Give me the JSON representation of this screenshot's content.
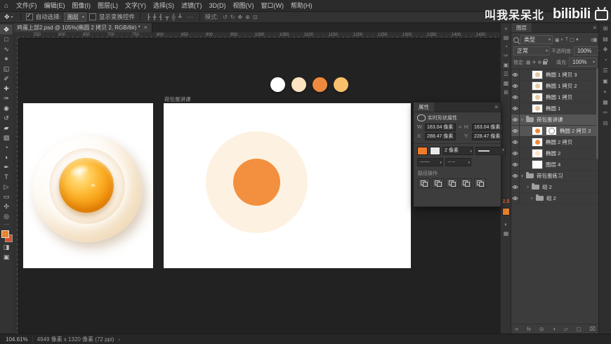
{
  "watermark": {
    "name": "叫我呆呆北",
    "logo": "bilibili"
  },
  "menu": {
    "home_icon": "⌂",
    "items": [
      "文件(F)",
      "编辑(E)",
      "图像(I)",
      "图层(L)",
      "文字(Y)",
      "选择(S)",
      "滤镜(T)",
      "3D(D)",
      "视图(V)",
      "窗口(W)",
      "帮助(H)"
    ]
  },
  "options": {
    "tool_icon": "✥",
    "auto_select_label": "自动选择:",
    "auto_select_value": "图层",
    "show_transform_label": "显示变换控件",
    "align_icons": [
      "┣",
      "╋",
      "┫",
      "┳",
      "╬",
      "┻"
    ],
    "more_icon": "⋯",
    "mode_label": "模式:",
    "mode_icons": [
      "↺",
      "↻",
      "✥",
      "⊕",
      "⊡"
    ]
  },
  "doc_tab": {
    "title": "鸡蛋上部2.psd @ 105%(椭圆 2 拷贝 2, RGB/8#) *",
    "close_icon": "×"
  },
  "ruler": {
    "labels": [
      "550",
      "600",
      "650",
      "700",
      "750",
      "800",
      "850",
      "900",
      "950",
      "1000",
      "1050",
      "1100",
      "1150",
      "1200",
      "1250",
      "1300",
      "1350",
      "1400",
      "1450"
    ]
  },
  "toolbar": {
    "tools": [
      {
        "name": "move-tool",
        "glyph": "✥",
        "cls": "active"
      },
      {
        "name": "marquee-tool",
        "glyph": "□"
      },
      {
        "name": "lasso-tool",
        "glyph": "∿"
      },
      {
        "name": "quick-selection-tool",
        "glyph": "✶"
      },
      {
        "name": "crop-tool",
        "glyph": "◱"
      },
      {
        "name": "eyedropper-tool",
        "glyph": "✐"
      },
      {
        "name": "healing-brush-tool",
        "glyph": "✚"
      },
      {
        "name": "brush-tool",
        "glyph": "✑"
      },
      {
        "name": "clone-stamp-tool",
        "glyph": "◉"
      },
      {
        "name": "history-brush-tool",
        "glyph": "↺"
      },
      {
        "name": "eraser-tool",
        "glyph": "▰"
      },
      {
        "name": "gradient-tool",
        "glyph": "▨"
      },
      {
        "name": "blur-tool",
        "glyph": "◔"
      },
      {
        "name": "dodge-tool",
        "glyph": "◖"
      },
      {
        "name": "pen-tool",
        "glyph": "✒"
      },
      {
        "name": "type-tool",
        "glyph": "T"
      },
      {
        "name": "path-selection-tool",
        "glyph": "▷"
      },
      {
        "name": "shape-tool",
        "glyph": "▭"
      },
      {
        "name": "hand-tool",
        "glyph": "✣"
      },
      {
        "name": "zoom-tool",
        "glyph": "◎"
      }
    ],
    "edit_toolbar_icon": "⋯",
    "quick_mask_icon": "◨",
    "screen_mode_icon": "▣",
    "foreground_color": "#e8832f",
    "background_color": "#d9502c"
  },
  "canvas": {
    "artboard_label": "荷包蛋讲课",
    "palette": [
      "#ffffff",
      "#fce3c2",
      "#ee8a3e",
      "#f8c06c"
    ],
    "flat_egg": {
      "white": "#fdf2e1",
      "yolk": "#f2903f"
    }
  },
  "properties": {
    "tab": "属性",
    "menu_icon": "≡",
    "header": "实时形状属性",
    "fields": {
      "w_label": "W:",
      "w": "163.04 像素",
      "h_label": "H:",
      "h": "163.04 像素",
      "link_icon": "∞",
      "x_label": "X:",
      "x": "288.47 像素",
      "y_label": "Y:",
      "y": "228.47 像素"
    },
    "fill_color": "#ee7d2a",
    "stroke_width": "2 像素",
    "stroke_option_icons": [
      "——",
      "– –"
    ],
    "path_ops_label": "路径操作"
  },
  "dock_strip": {
    "icons_top": [
      "«",
      "▤",
      "◔",
      "✑",
      "▣",
      "☰",
      "▩",
      "⊞"
    ],
    "badge": "2.5",
    "badge_color": "#e8622c",
    "swatch_color": "#e8832f",
    "icons_bottom": [
      "◐",
      "▦"
    ]
  },
  "layers": {
    "tab": "图层",
    "menu_icon": "≡",
    "search_label": "类型",
    "filter_icons": [
      "▣",
      "◐",
      "T",
      "▢",
      "●"
    ],
    "blend_mode": "正常",
    "opacity_label": "不透明度:",
    "opacity_value": "100%",
    "lock_label": "锁定:",
    "lock_icons": [
      "▦",
      "✛",
      "⊕"
    ],
    "fill_label": "填充:",
    "fill_value": "100%",
    "rows": [
      {
        "name": "椭圆 1 拷贝 3",
        "cls": "shape ind1",
        "dot": "#e8c9a0"
      },
      {
        "name": "椭圆 1 拷贝 2",
        "cls": "shape ind1",
        "dot": "#e8c9a0"
      },
      {
        "name": "椭圆 1 拷贝",
        "cls": "shape ind1",
        "dot": "#e8c9a0"
      },
      {
        "name": "椭圆 1",
        "cls": "shape ind1",
        "dot": "#e8c9a0"
      },
      {
        "name": "荷包蛋讲课",
        "cls": "group sel",
        "caret": "∨"
      },
      {
        "name": "椭圆 2 拷贝 2",
        "cls": "shape sel ind1 masked",
        "dot": "#ee8a3e"
      },
      {
        "name": "椭圆 2 拷贝",
        "cls": "shape ind1",
        "dot": "#ee8a3e"
      },
      {
        "name": "椭圆 2",
        "cls": "shape ind1",
        "dot": "#fce3c2"
      },
      {
        "name": "图层 4",
        "cls": "pix ind1",
        "dot": "#ffffff"
      },
      {
        "name": "荷包蛋练习",
        "cls": "group",
        "caret": "∨"
      },
      {
        "name": "组 2",
        "cls": "group ind1",
        "caret": ">"
      },
      {
        "name": "组 2",
        "cls": "group ind2",
        "caret": ">"
      }
    ],
    "bottom_icons": [
      "∞",
      "fx",
      "◎",
      "◑",
      "▱",
      "▢",
      "⌧"
    ]
  },
  "right_dock": {
    "icons": [
      "⊞",
      "▤",
      "✥",
      "◔",
      "☰",
      "▣",
      "◐",
      "▦",
      "✑",
      "⊟"
    ]
  },
  "status": {
    "zoom": "104.61%",
    "doc_info": "4949 像素 x 1320 像素 (72 ppi)",
    "arrow_icon": "›"
  }
}
